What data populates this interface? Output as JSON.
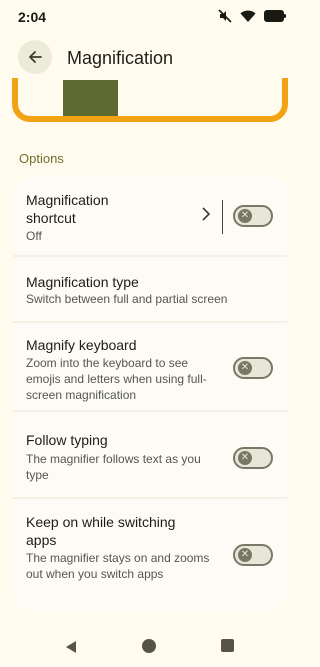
{
  "status": {
    "time": "2:04"
  },
  "app_bar": {
    "title": "Magnification"
  },
  "section": {
    "title": "Options"
  },
  "settings": [
    {
      "title": "Magnification shortcut",
      "subtitle": "Off",
      "toggle_on": false
    },
    {
      "title": "Magnification type",
      "subtitle": "Switch between full and partial screen"
    },
    {
      "title": "Magnify keyboard",
      "subtitle": "Zoom into the keyboard to see emojis and letters when using full-screen magnification",
      "toggle_on": false
    },
    {
      "title": "Follow typing",
      "subtitle": "The magnifier follows text as you type",
      "toggle_on": false
    },
    {
      "title": "Keep on while switching apps",
      "subtitle": "The magnifier stays on and zooms out when you switch apps",
      "toggle_on": false
    }
  ],
  "colors": {
    "accent": "#f2a313",
    "background": "#fffcef",
    "card": "#fdfbf6",
    "section_title": "#6e6f2c"
  },
  "icons": [
    "mute-icon",
    "wifi-icon",
    "battery-icon",
    "back-arrow-icon",
    "chevron-right-icon",
    "close-icon",
    "info-icon"
  ]
}
